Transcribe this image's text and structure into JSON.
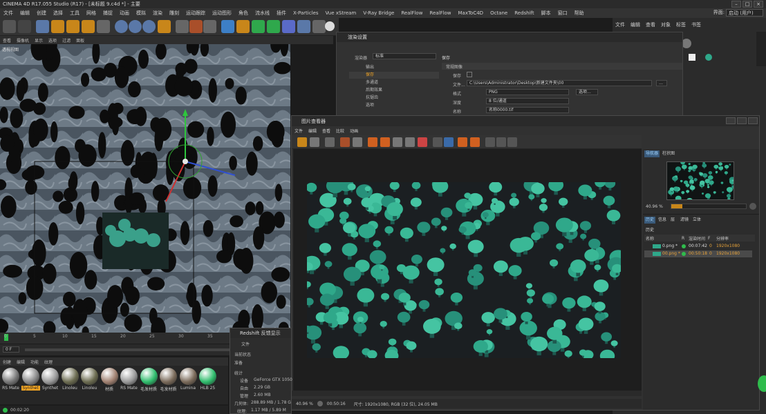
{
  "app_title": "CINEMA 4D R17.055 Studio (R17) - [未标题 9.c4d *] - 主要",
  "menu": [
    "文件",
    "编辑",
    "创建",
    "选择",
    "工具",
    "网格",
    "捕捉",
    "动画",
    "模拟",
    "渲染",
    "雕刻",
    "运动跟踪",
    "运动图形",
    "角色",
    "流水线",
    "插件",
    "X-Particles",
    "Vue xStream",
    "V-Ray Bridge",
    "RealFlow",
    "RealFlow",
    "MaxToC4D",
    "Octane",
    "Redshift",
    "脚本",
    "窗口",
    "帮助"
  ],
  "layout": {
    "label": "界面:",
    "value": "启动 (用户)"
  },
  "viewport": {
    "menu": [
      "查看",
      "摄像机",
      "显示",
      "选项",
      "过滤",
      "面板"
    ],
    "label": "透视视图"
  },
  "timeline": {
    "ticks": [
      "0",
      "5",
      "10",
      "15",
      "20",
      "25",
      "30",
      "35"
    ],
    "frame": "0 F"
  },
  "materials": {
    "menu": [
      "创建",
      "编辑",
      "功能",
      "纹理"
    ],
    "items": [
      "RS Mate",
      "Synthet",
      "Synthet",
      "Linoleu",
      "Linoleu",
      "材质",
      "RS Mate",
      "毛发材质",
      "毛发材质",
      "Lumina",
      "HLB 25"
    ]
  },
  "status_time": "00:02:20",
  "render_settings": {
    "title": "渲染设置",
    "renderer_label": "渲染器",
    "renderer_value": "标准",
    "items": [
      "输出",
      "保存",
      "多通道",
      "后期效果",
      "抗锯齿",
      "选项"
    ],
    "section": "保存",
    "subsection": "常规图像",
    "save_label": "保存",
    "file_label": "文件...",
    "file_path": "C:\\Users\\Administrator\\Desktop\\新建文件夹\\00",
    "format_label": "格式",
    "format_value": "PNG",
    "options_btn": "选项...",
    "depth_label": "深度",
    "depth_value": "8 位/通道",
    "name_label": "名称",
    "name_value": "名称0000.tif"
  },
  "object_manager": {
    "menu": [
      "文件",
      "编辑",
      "查看",
      "对象",
      "标签",
      "书签"
    ]
  },
  "picture_viewer": {
    "title": "图片查看器",
    "menu": [
      "文件",
      "编辑",
      "查看",
      "比较",
      "动画"
    ],
    "tabs": [
      "导航器",
      "柱状图"
    ],
    "zoom": "40.96 %",
    "tabs2": [
      "历史",
      "信息",
      "层",
      "滤镜",
      "立体"
    ],
    "history_label": "历史",
    "columns": [
      "名称",
      "R",
      "渲染时间",
      "F",
      "分辨率"
    ],
    "history": [
      {
        "name": "0.png *",
        "time": "00:07:42",
        "f": "0",
        "res": "1920x1080"
      },
      {
        "name": "00.png *",
        "time": "00:50:18",
        "f": "0",
        "res": "1920x1080"
      }
    ],
    "status_zoom": "40.96 %",
    "status_time": "00:50:16",
    "status_info": "尺寸: 1920x1080, RGB (32 位), 24.05 MB"
  },
  "redshift": {
    "title": "Redshift 反馈显示",
    "menu": "文件",
    "state_label": "当前状态",
    "state_value": "准备",
    "stats_label": "统计",
    "device_label": "设备",
    "device_value": "GeForce GTX 1050",
    "free_label": "自由",
    "free_value": "2.29 GB",
    "mgmt_label": "管理",
    "mgmt_value": "2.60 MB",
    "geo_label": "几何体:",
    "geo_value": "288.89 MB / 1.78 G",
    "tex_label": "纹理:",
    "tex_value": "1.17 MB / 5.89 M"
  },
  "colors": {
    "accent": "#f5a623",
    "teal": "#2fa88a",
    "active_tab": "#3a5a7a"
  }
}
